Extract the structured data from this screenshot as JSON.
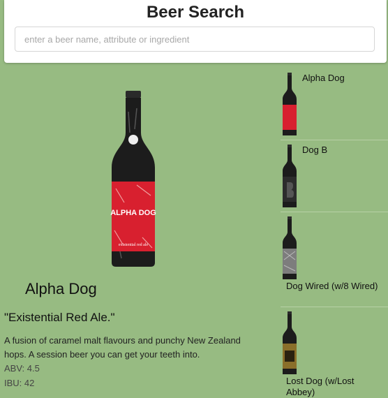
{
  "app": {
    "title": "Beer Search",
    "search_placeholder": "enter a beer name, attribute or ingredient",
    "search_value": ""
  },
  "detail": {
    "name": "Alpha Dog",
    "tagline": "\"Existential Red Ale.\"",
    "description": "A fusion of caramel malt flavours and punchy New Zealand hops. A session beer you can get your teeth into.",
    "abv_text": "ABV: 4.5",
    "ibu_text": "IBU: 42",
    "label_brand": "ALPHA DOG",
    "label_sub": "existential red ale"
  },
  "beers": [
    {
      "name": "Alpha Dog",
      "label_color": "#d8202f"
    },
    {
      "name": "Dog B",
      "label_color": "#2c2c2c"
    },
    {
      "name": "Dog Wired (w/8 Wired)",
      "label_color": "#7d7d7d"
    },
    {
      "name": "Lost Dog (w/Lost Abbey)",
      "label_color": "#8a6f2a"
    }
  ],
  "colors": {
    "background": "#97bb82",
    "bottle": "#1c1c1c",
    "accent_red": "#d8202f"
  }
}
